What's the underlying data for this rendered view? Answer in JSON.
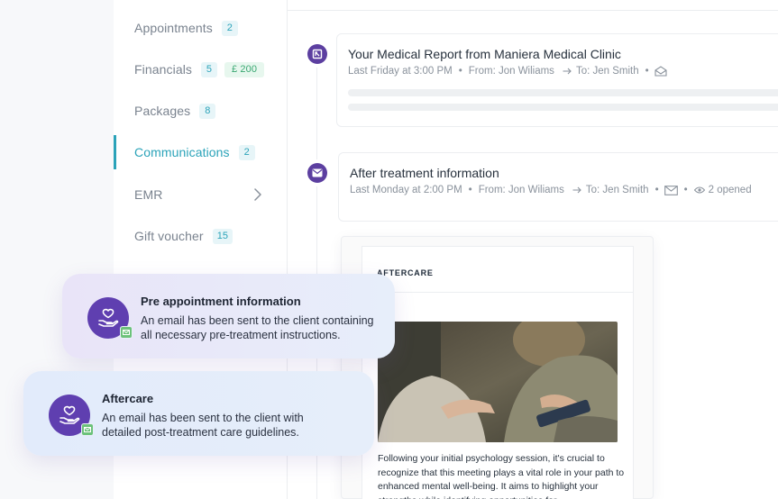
{
  "sidebar": {
    "items": [
      {
        "label": "Appointments",
        "badge": "2"
      },
      {
        "label": "Financials",
        "badge": "5",
        "amount": "£ 200"
      },
      {
        "label": "Packages",
        "badge": "8"
      },
      {
        "label": "Communications",
        "badge": "2",
        "active": true
      },
      {
        "label": "EMR"
      },
      {
        "label": "Gift voucher",
        "badge": "15"
      }
    ]
  },
  "timeline": {
    "entries": [
      {
        "title": "Your Medical Report from Maniera Medical Clinic",
        "time": "Last Friday at 3:00 PM",
        "from": "From: Jon Wiliams",
        "to": "To: Jen Smith"
      },
      {
        "title": "After treatment information",
        "time": "Last Monday at 2:00 PM",
        "from": "From: Jon Wiliams",
        "to": "To: Jen Smith",
        "opened": "2 opened"
      }
    ]
  },
  "email_preview": {
    "header": "AFTERCARE",
    "body": "Following your initial psychology session, it's crucial to recognize that this meeting plays a vital role in your path to enhanced mental well-being. It aims to highlight your strengths while identifying opportunities for"
  },
  "toasts": [
    {
      "title": "Pre appointment information",
      "text": "An email has been sent to the client containing all necessary pre-treatment instructions."
    },
    {
      "title": "Aftercare",
      "text": "An email has been sent to the client with detailed post-treatment care guidelines."
    }
  ],
  "colors": {
    "accent": "#2ba3b9",
    "purple": "#5c3fa0",
    "money": "#3aa872"
  },
  "icons": {
    "report": "report-icon",
    "mail": "envelope-icon",
    "heart_hand": "heart-hand-icon",
    "eye": "eye-icon",
    "arrow": "arrow-right-icon",
    "chevron": "chevron-right-icon"
  }
}
